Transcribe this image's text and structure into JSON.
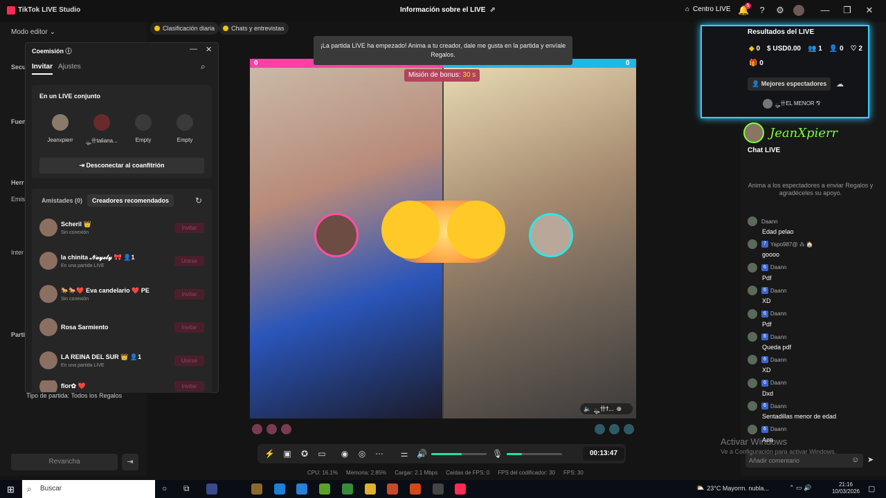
{
  "app": {
    "title": "TikTok LIVE Studio",
    "mode": "Modo editor ⌄",
    "header": "Información sobre el LIVE",
    "centro_live": "Centro LIVE",
    "notif_count": "5"
  },
  "chips": [
    {
      "label": "Clasificación diaria"
    },
    {
      "label": "Chats y entrevistas"
    }
  ],
  "toast": {
    "line1": "¡La partida LIVE ha empezado! Anima a tu creador, dale me gusta en la partida y envíale",
    "line2": "Regalos."
  },
  "match": {
    "score_left": "0",
    "score_right": "0",
    "bonus_label": "Misión de bonus:",
    "bonus_time": "30 s",
    "opponent_tag": "ౣ卄ϯ..."
  },
  "controls": {
    "timer": "00:13:47",
    "speaker_level": 0.55,
    "mic_level": 0.28
  },
  "stats": {
    "cpu": "CPU:  16.1%",
    "memoria": "Memoria:  2.85%",
    "cargar": "Cargar:  2.1 Mbps",
    "caidas": "Caídas de FPS:  0",
    "fps_cod": "FPS del codificador:  30",
    "fps": "FPS:  30"
  },
  "left": {
    "peek_labels": [
      "Secu",
      "Fuen",
      "Herr",
      "Emisi",
      "Inter",
      "Parti"
    ],
    "partida_tipo": "Tipo de partida: Todos los Regalos",
    "revancha": "Revancha"
  },
  "popup": {
    "title": "Coemisión",
    "tab_invitar": "Invitar",
    "tab_ajustes": "Ajustes",
    "joint_title": "En un LIVE conjunto",
    "slots": [
      "Jeanxpierr",
      "ౣ卄taliana...",
      "Empty",
      "Empty"
    ],
    "disconnect": "Desconectar al coanfitrión",
    "seg_friends": "Amistades (0)",
    "seg_reco": "Creadores recomendados",
    "friends": [
      {
        "name": "Scheril 👑",
        "status": "Sin conexión",
        "button": "Invitar"
      },
      {
        "name": "la chinita 𝓝𝓪𝔂𝓮𝓵𝔂 🎀   👤1",
        "status": "En una partida LIVE",
        "button": "Unirse"
      },
      {
        "name": "🐎🐎❤️ Eva candelario ❤️ PE",
        "status": "Sin conexión",
        "button": "Invitar"
      },
      {
        "name": "Rosa Sarmiento",
        "status": "",
        "button": "Invitar"
      },
      {
        "name": "LA REINA DEL SUR 👑   👤1",
        "status": "En una partida LIVE",
        "button": "Unirse"
      },
      {
        "name": "flor✿ ❤️",
        "status": "",
        "button": "Invitar"
      }
    ]
  },
  "results": {
    "title": "Resultados del LIVE",
    "coins": "0",
    "usd": "USD0.00",
    "viewers": "1",
    "new_followers": "0",
    "likes": "2",
    "gifts": "0",
    "best_viewers_label": "Mejores espectadores",
    "best_viewer": "ౣ卄EL MENOR ⅋"
  },
  "streamer_overlay": "JeanXpierr",
  "chat": {
    "title": "Chat LIVE",
    "hint": "Anima a los espectadores a enviar Regalos y agradéceles su apoyo.",
    "messages": [
      {
        "badge": "",
        "user": "Daann",
        "text": "Edad pelao"
      },
      {
        "badge": "7",
        "user": "Yapo987@ ⁂ 🏠",
        "text": "goooo"
      },
      {
        "badge": "6",
        "user": "Daann",
        "text": "Pdf"
      },
      {
        "badge": "6",
        "user": "Daann",
        "text": "XD"
      },
      {
        "badge": "6",
        "user": "Daann",
        "text": "Pdf"
      },
      {
        "badge": "6",
        "user": "Daann",
        "text": "Queda pdf"
      },
      {
        "badge": "6",
        "user": "Daann",
        "text": "XD"
      },
      {
        "badge": "6",
        "user": "Daann",
        "text": "Dxd"
      },
      {
        "badge": "6",
        "user": "Daann",
        "text": "Sentadillas menor de edad"
      },
      {
        "badge": "6",
        "user": "Daann",
        "text": "Aea"
      }
    ],
    "input_placeholder": "Añadir comentario"
  },
  "windows": {
    "watermark": "Activar Windows",
    "watermark_sub": "Ve a Configuración para activar Windows.",
    "search": "Buscar",
    "weather": "23°C  Mayorm. nubla...",
    "time": "21:16",
    "date": "10/03/2026"
  }
}
